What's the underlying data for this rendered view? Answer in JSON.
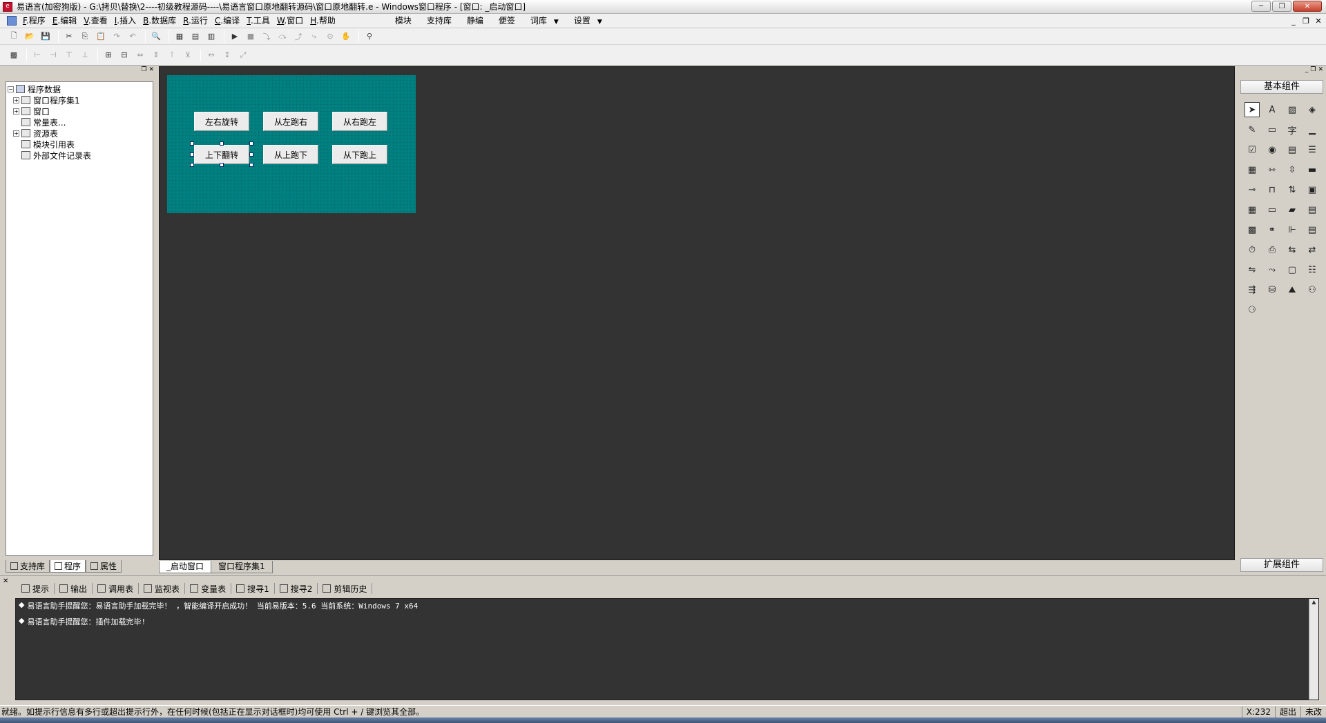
{
  "window": {
    "title": "易语言(加密狗版) - G:\\拷贝\\替换\\2----初级教程源码----\\易语言窗口原地翻转源码\\窗口原地翻转.e - Windows窗口程序 - [窗口: _启动窗口]",
    "min": "─",
    "max": "❐",
    "close": "✕"
  },
  "menu": {
    "items": [
      {
        "key": "F",
        "label": ".程序"
      },
      {
        "key": "E",
        "label": ".编辑"
      },
      {
        "key": "V",
        "label": ".查看"
      },
      {
        "key": "I",
        "label": ".插入"
      },
      {
        "key": "B",
        "label": ".数据库"
      },
      {
        "key": "R",
        "label": ".运行"
      },
      {
        "key": "C",
        "label": ".编译"
      },
      {
        "key": "T",
        "label": ".工具"
      },
      {
        "key": "W",
        "label": ".窗口"
      },
      {
        "key": "H",
        "label": ".帮助"
      }
    ],
    "extras": [
      "模块",
      "支持库",
      "静编",
      "便签",
      "词库",
      "设置"
    ]
  },
  "tree": {
    "root": "程序数据",
    "items": [
      "窗口程序集1",
      "窗口",
      "常量表...",
      "资源表",
      "模块引用表",
      "外部文件记录表"
    ]
  },
  "left_tabs": [
    "支持库",
    "程序",
    "属性"
  ],
  "design": {
    "buttons": [
      "左右旋转",
      "从左跑右",
      "从右跑左",
      "上下翻转",
      "从上跑下",
      "从下跑上"
    ],
    "tabs": [
      "_启动窗口",
      "窗口程序集1"
    ],
    "form_color": "#008080"
  },
  "right_panel": {
    "header": "基本组件",
    "footer": "扩展组件"
  },
  "output": {
    "tabs": [
      "提示",
      "输出",
      "调用表",
      "监视表",
      "变量表",
      "搜寻1",
      "搜寻2",
      "剪辑历史"
    ],
    "lines": [
      "易语言助手提醒您：易语言助手加载完毕！ ，智能编译开启成功！ 当前易版本：5.6  当前系统：Windows 7 x64",
      "易语言助手提醒您：插件加载完毕!"
    ]
  },
  "status": {
    "message": "就绪。如提示行信息有多行或超出提示行外，在任何时候(包括正在显示对话框时)均可使用 Ctrl + / 键浏览其全部。",
    "coord": "X:232",
    "mode": "超出",
    "saved": "未改"
  }
}
